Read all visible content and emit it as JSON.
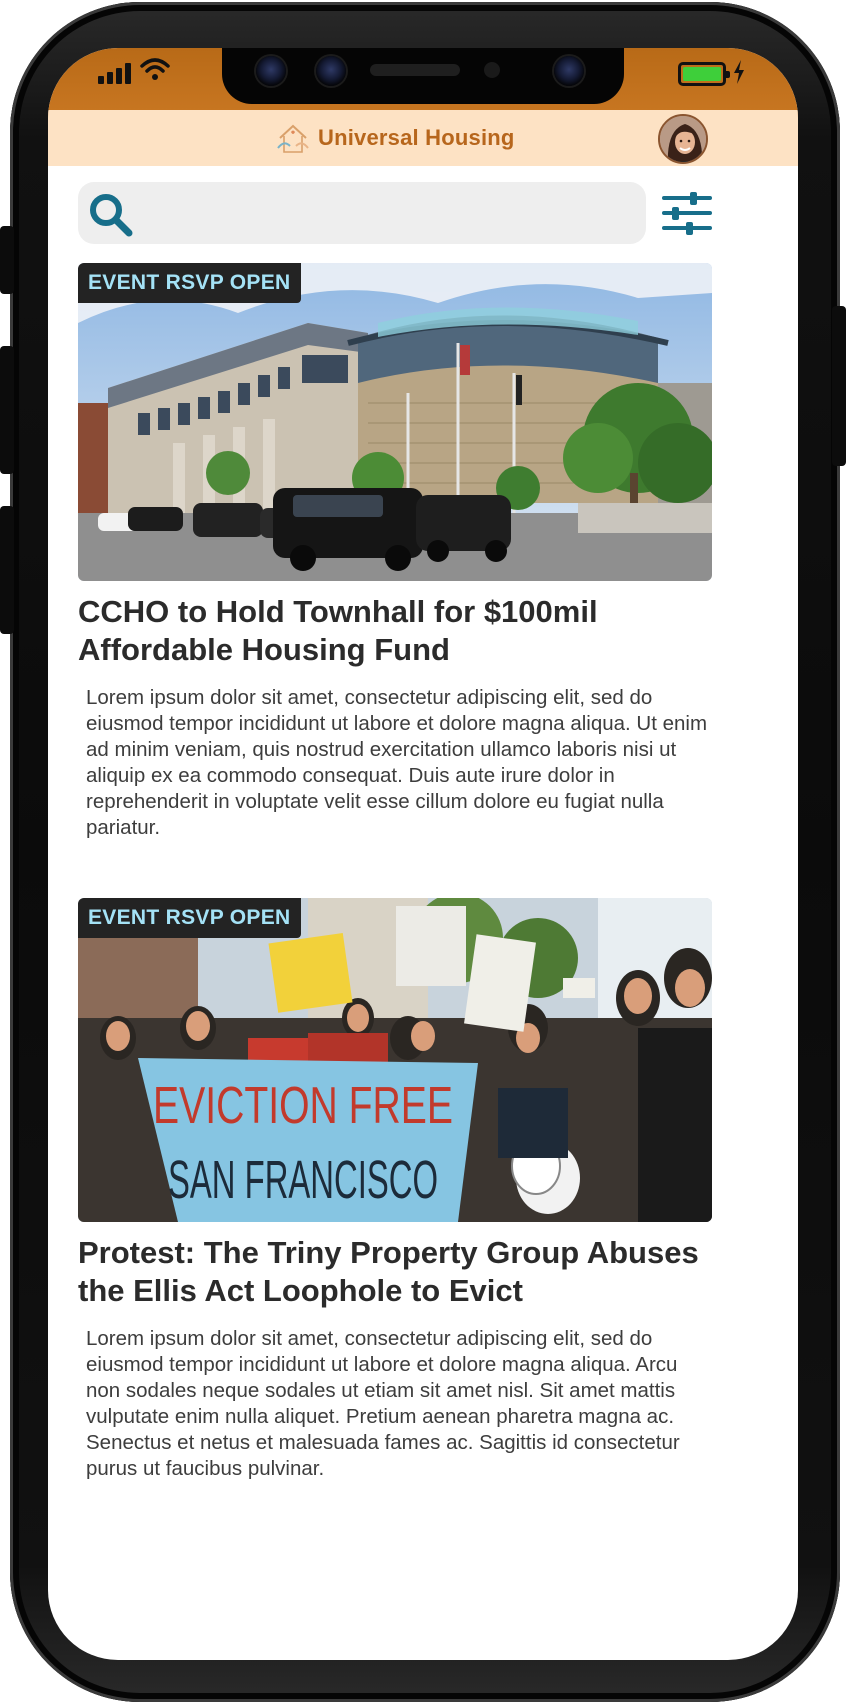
{
  "app": {
    "name": "Universal Housing"
  },
  "search": {
    "placeholder": "",
    "value": ""
  },
  "icons": {
    "search": "search-icon",
    "filter": "sliders-icon",
    "logo": "house-hands-logo",
    "signal": "cellular-signal-icon",
    "wifi": "wifi-icon",
    "battery": "battery-icon",
    "charging": "lightning-bolt-icon"
  },
  "colors": {
    "statusbar": "#c0701c",
    "header_bg": "#fde2c4",
    "brand": "#b7661c",
    "accent": "#1a6f8c",
    "badge_bg": "#232323",
    "badge_text": "#a4e2f6"
  },
  "articles": [
    {
      "badge": "EVENT RSVP OPEN",
      "headline": "CCHO to Hold Townhall for $100mil Affordable Housing Fund",
      "body": "Lorem ipsum dolor sit amet, consectetur adipiscing elit, sed do eiusmod tempor incididunt ut labore et dolore magna aliqua. Ut enim ad minim veniam, quis nostrud exercitation ullamco laboris nisi ut aliquip ex ea commodo consequat. Duis aute irure dolor in reprehenderit in voluptate velit esse cillum dolore eu fugiat nulla pariatur."
    },
    {
      "badge": "EVENT RSVP OPEN",
      "headline": "Protest: The Triny Property Group Abuses the Ellis Act Loophole to Evict",
      "body": "Lorem ipsum dolor sit amet, consectetur adipiscing elit, sed do eiusmod tempor incididunt ut labore et dolore magna aliqua. Arcu non sodales neque sodales ut etiam sit amet nisl. Sit amet mattis vulputate enim nulla aliquet. Pretium aenean pharetra magna ac. Senectus et netus et malesuada fames ac. Sagittis id consectetur purus ut faucibus pulvinar.",
      "image_banner_text": [
        "EVICTION FREE",
        "SAN FRANCISCO"
      ]
    }
  ]
}
